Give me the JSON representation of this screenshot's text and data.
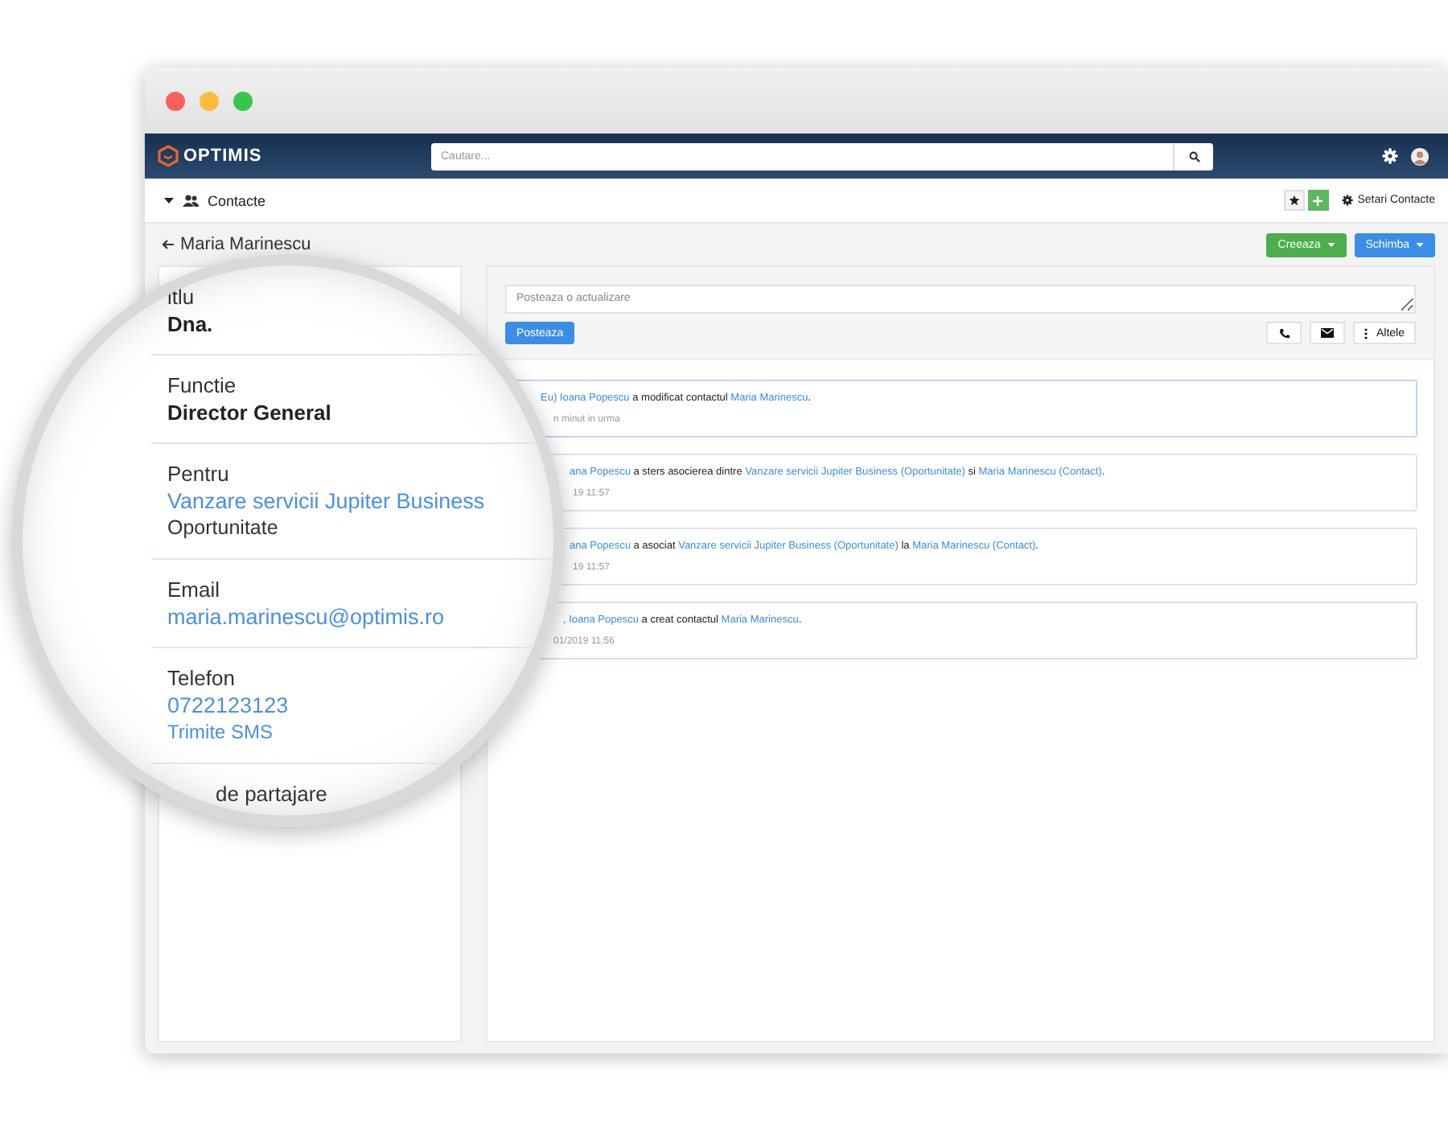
{
  "navbar": {
    "logo": "OPTIMIS",
    "search": {
      "placeholder": "Cautare..."
    }
  },
  "subheader": {
    "module": "Contacte",
    "settings": "Setari Contacte"
  },
  "page": {
    "title": "Maria Marinescu",
    "buttons": [
      {
        "label": "Creeaza",
        "color": "#4cae4c"
      },
      {
        "label": "Schimba",
        "color": "#3a8ee6"
      }
    ]
  },
  "composer": {
    "placeholder": "Posteaza o actualizare",
    "post": "Posteaza",
    "more": "Altele"
  },
  "feed": [
    {
      "color": "#bcd6f5",
      "parts": [
        {
          "kind": "link",
          "text": "Eu) Ioana Popescu"
        },
        {
          "kind": "text",
          "text": " a modificat contactul "
        },
        {
          "kind": "link",
          "text": "Maria Marinescu"
        },
        {
          "kind": "text",
          "text": "."
        }
      ],
      "time": "n minut in urma"
    },
    {
      "color": "#e0e4ea",
      "parts": [
        {
          "kind": "link",
          "text": "ana Popescu"
        },
        {
          "kind": "text",
          "text": " a sters asocierea dintre "
        },
        {
          "kind": "link",
          "text": "Vanzare servicii Jupiter Business (Oportunitate)"
        },
        {
          "kind": "text",
          "text": " si "
        },
        {
          "kind": "link",
          "text": "Maria Marinescu (Contact)"
        },
        {
          "kind": "text",
          "text": "."
        }
      ],
      "time": "19 11:57"
    },
    {
      "color": "#e0e4ea",
      "parts": [
        {
          "kind": "link",
          "text": "ana Popescu"
        },
        {
          "kind": "text",
          "text": " a asociat "
        },
        {
          "kind": "link",
          "text": "Vanzare servicii Jupiter Business (Oportunitate)"
        },
        {
          "kind": "text",
          "text": " la "
        },
        {
          "kind": "link",
          "text": "Maria Marinescu (Contact)"
        },
        {
          "kind": "text",
          "text": "."
        }
      ],
      "time": "19 11:57"
    },
    {
      "color": "#cde8cd",
      "parts": [
        {
          "kind": "link",
          "text": ", Ioana Popescu"
        },
        {
          "kind": "text",
          "text": " a creat contactul "
        },
        {
          "kind": "link",
          "text": "Maria Marinescu"
        },
        {
          "kind": "text",
          "text": "."
        }
      ],
      "time": "01/2019 11:56"
    }
  ],
  "details": [
    {
      "label": "itlu",
      "values": [
        {
          "kind": "text",
          "text": "Dna."
        }
      ]
    },
    {
      "label": "Functie",
      "values": [
        {
          "kind": "text",
          "text": "Director General"
        }
      ]
    },
    {
      "label": "Pentru",
      "values": [
        {
          "kind": "link",
          "text": "Vanzare servicii Jupiter Business"
        },
        {
          "kind": "note",
          "text": "Oportunitate"
        }
      ]
    },
    {
      "label": "Email",
      "values": [
        {
          "kind": "link",
          "text": "maria.marinescu@optimis.ro"
        }
      ]
    },
    {
      "label": "Telefon",
      "values": [
        {
          "kind": "link",
          "text": "0722123123"
        },
        {
          "kind": "small-link",
          "text": "Trimite SMS"
        }
      ]
    },
    {
      "label": "de partajare"
    }
  ]
}
